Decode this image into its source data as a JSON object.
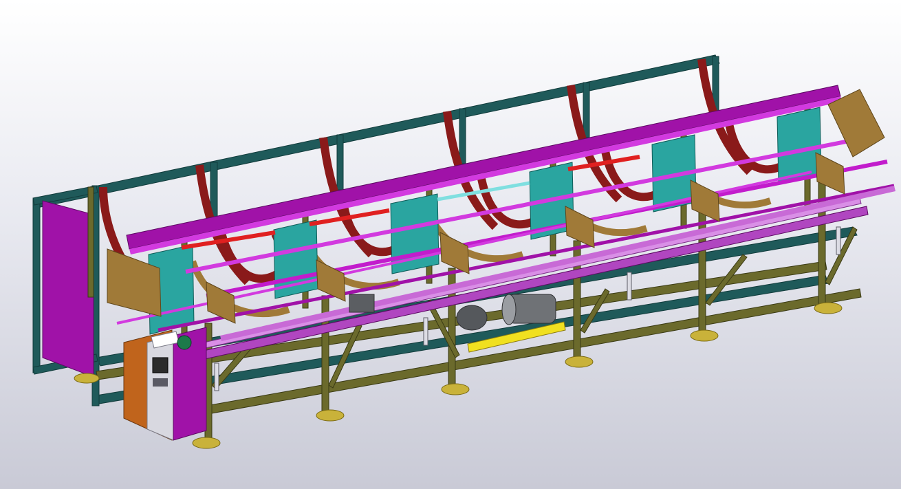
{
  "viewport": {
    "background_top": "#ffffff",
    "background_bottom": "#c9cad6"
  },
  "model": {
    "colors": {
      "frame_outer": "#1f5a5a",
      "frame_inner": "#6b6a2c",
      "magenta": "#a012a8",
      "magenta_light": "#d23adf",
      "belt": "#8a1a1a",
      "tan": "#a07a38",
      "teal_plate": "#2aa5a0",
      "red_rod": "#e02020",
      "cyan_rod": "#7fdfe0",
      "motor": "#6f7276",
      "yellow": "#f0e020",
      "cabinet_orange": "#c0641c",
      "cabinet_panel": "#d8d8e0",
      "foot": "#c9b23a"
    }
  }
}
